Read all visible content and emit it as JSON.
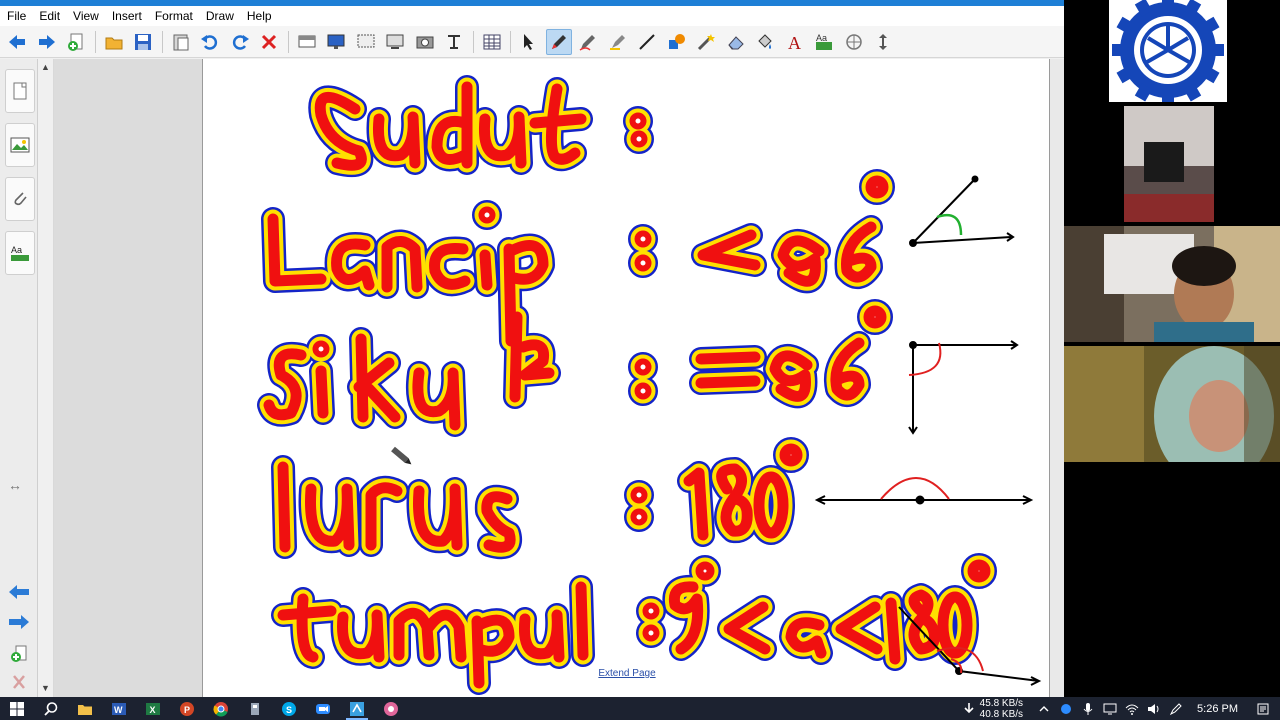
{
  "menu": {
    "items": [
      "File",
      "Edit",
      "View",
      "Insert",
      "Format",
      "Draw",
      "Help"
    ]
  },
  "toolbar": {
    "icons": [
      "back-arrow-icon",
      "forward-arrow-icon",
      "add-page-icon",
      "open-folder-icon",
      "save-icon",
      "paste-icon",
      "undo-icon",
      "redo-icon",
      "delete-icon",
      "screen-shade-icon",
      "display-icon",
      "capture-icon",
      "screen-capture-icon",
      "camera-icon",
      "table-icon",
      "select-pointer-icon",
      "pen-icon",
      "creative-pen-icon",
      "highlighter-icon",
      "line-icon",
      "shapes-icon",
      "magic-pen-icon",
      "eraser-icon",
      "fill-icon",
      "text-icon",
      "properties-icon",
      "measurement-icon",
      "move-toolbar-icon"
    ]
  },
  "canvas": {
    "extend_link": "Extend Page",
    "ink_words": {
      "title": "Sudut",
      "colon": ":",
      "row1_name": "Lancip",
      "row1_value": "< 90°",
      "row2_name": "siku²",
      "row2_value": "= 90°",
      "row3_name": "Lurus",
      "row3_value": "180°",
      "row4_name": "tumpul",
      "row4_value": "90°< a <180°"
    },
    "ink_colors": {
      "fill": "#f01010",
      "inner": "#ffe000",
      "outline": "#1424c8",
      "diagram": "#000000",
      "arc": "#e02020",
      "arc_green": "#22b030"
    }
  },
  "taskbar": {
    "apps": [
      "windows-start-icon",
      "search-icon",
      "file-explorer-icon",
      "word-icon",
      "excel-icon",
      "powerpoint-icon",
      "chrome-icon",
      "app-icon",
      "skype-icon",
      "zoom-icon",
      "smartboard-icon",
      "browser-icon"
    ],
    "network_up": "45.8 KB/s",
    "network_down": "40.8 KB/s",
    "time": "5:26 PM"
  },
  "video": {
    "participants": [
      "school-logo",
      "participant-2",
      "participant-3",
      "participant-4"
    ]
  }
}
